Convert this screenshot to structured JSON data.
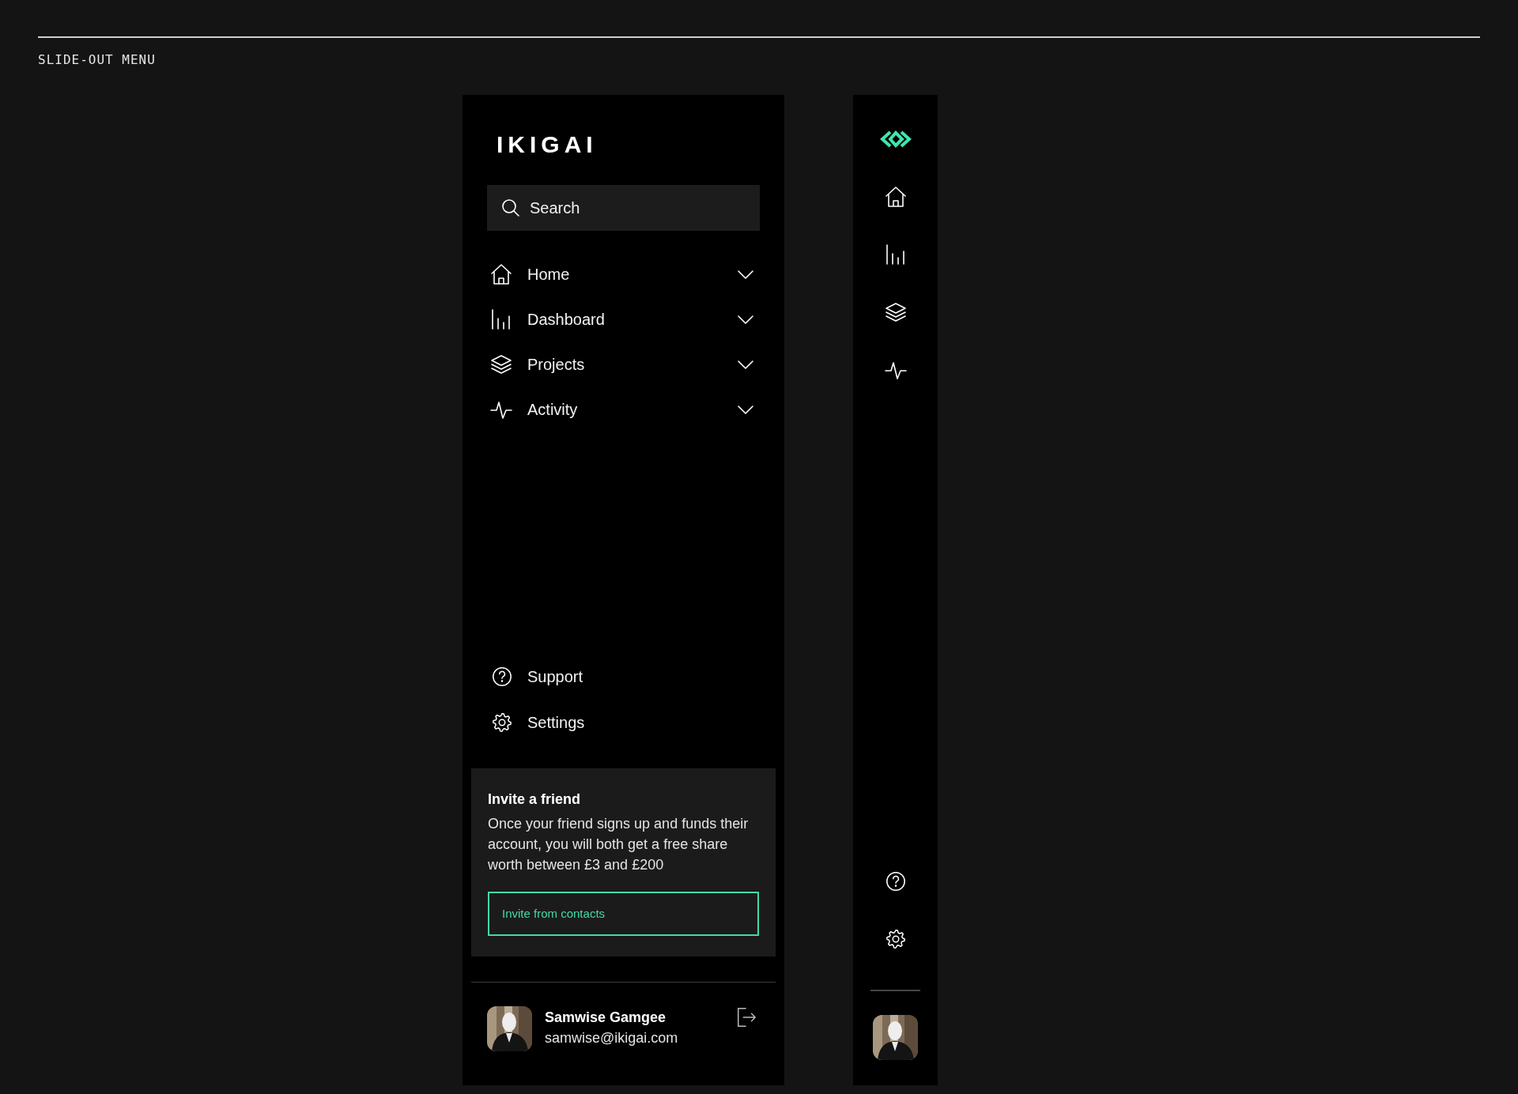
{
  "header": {
    "label": "SLIDE-OUT MENU"
  },
  "menu": {
    "brand": "IKIGAI",
    "search": {
      "placeholder": "Search"
    },
    "nav": [
      {
        "label": "Home",
        "expanded": false
      },
      {
        "label": "Dashboard",
        "expanded": false
      },
      {
        "label": "Projects",
        "expanded": false
      },
      {
        "label": "Activity",
        "expanded": false
      }
    ],
    "footer_links": [
      {
        "label": "Support"
      },
      {
        "label": "Settings"
      }
    ],
    "invite": {
      "title": "Invite a friend",
      "text": "Once your friend signs up and funds their account, you will both get a free share worth between £3 and £200",
      "button": "Invite from contacts"
    },
    "user": {
      "name": "Samwise Gamgee",
      "email": "samwise@ikigai.com"
    }
  }
}
